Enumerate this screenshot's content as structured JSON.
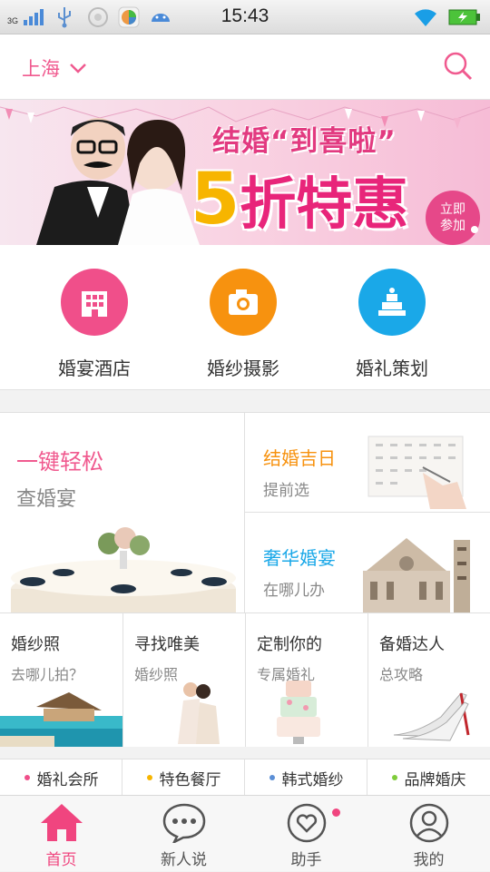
{
  "statusbar": {
    "time": "15:43",
    "network": "3G"
  },
  "header": {
    "city": "上海"
  },
  "banner": {
    "title": "结婚“到喜啦”",
    "discount_num": "5",
    "discount_text": "折特惠",
    "cta": [
      "立即",
      "参加"
    ]
  },
  "categories": [
    {
      "label": "婚宴酒店",
      "color": "#f04f8a",
      "icon": "building-icon"
    },
    {
      "label": "婚纱摄影",
      "color": "#f7920f",
      "icon": "camera-icon"
    },
    {
      "label": "婚礼策划",
      "color": "#1aa8e8",
      "icon": "cake-icon"
    }
  ],
  "grid": {
    "big": {
      "title": "一键轻松",
      "sub": "查婚宴"
    },
    "date": {
      "title": "结婚吉日",
      "sub": "提前选"
    },
    "lux": {
      "title": "奢华婚宴",
      "sub": "在哪儿办"
    },
    "small": [
      {
        "title": "婚纱照",
        "sub": "去哪儿拍？"
      },
      {
        "title": "寻找唯美",
        "sub": "婚纱照"
      },
      {
        "title": "定制你的",
        "sub": "专属婚礼"
      },
      {
        "title": "备婚达人",
        "sub": "总攻略"
      }
    ]
  },
  "tags": [
    {
      "label": "婚礼会所",
      "color": "#f04f8a"
    },
    {
      "label": "特色餐厅",
      "color": "#f7b500"
    },
    {
      "label": "韩式婚纱",
      "color": "#5b8fd6"
    },
    {
      "label": "品牌婚庆",
      "color": "#7fcc3a"
    }
  ],
  "nav": [
    {
      "label": "首页",
      "active": true
    },
    {
      "label": "新人说"
    },
    {
      "label": "助手"
    },
    {
      "label": "我的"
    }
  ]
}
